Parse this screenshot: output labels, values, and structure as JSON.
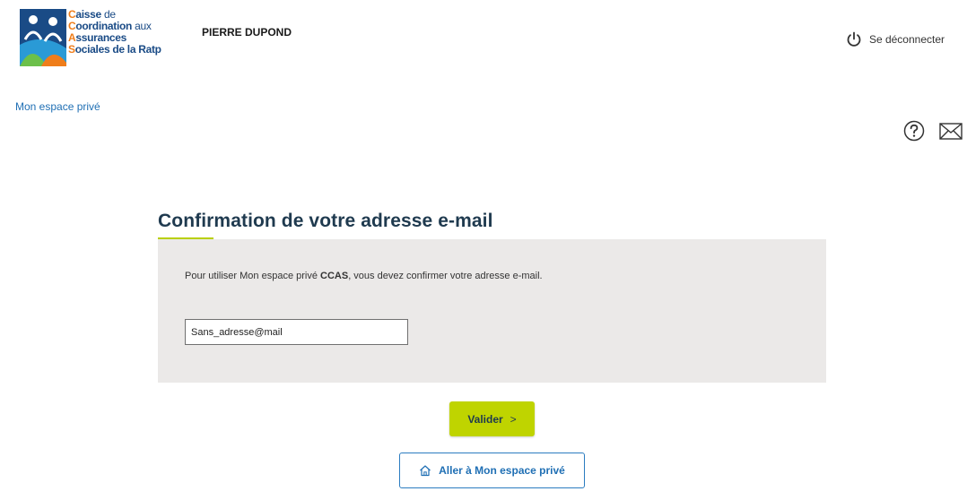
{
  "header": {
    "logo": {
      "lines": [
        {
          "cap": "C",
          "rest": "aisse",
          "light": " de"
        },
        {
          "cap": "C",
          "rest": "oordination",
          "light": " aux"
        },
        {
          "cap": "A",
          "rest": "ssurances",
          "light": ""
        },
        {
          "cap": "S",
          "rest": "ociales de la Ratp",
          "light": ""
        }
      ]
    },
    "user_name": "PIERRE DUPOND",
    "logout_label": "Se déconnecter",
    "breadcrumb": "Mon espace privé"
  },
  "main": {
    "title": "Confirmation de votre adresse e-mail",
    "instruction_before": "Pour utiliser Mon espace privé ",
    "instruction_bold": "CCAS",
    "instruction_after": ", vous devez confirmer votre adresse e-mail.",
    "email_value": "Sans_adresse@mail",
    "validate_label": "Valider",
    "validate_chevron": ">",
    "home_label": "Aller à Mon espace privé"
  },
  "icons": {
    "logout": "power-icon",
    "help": "question-icon",
    "mail": "envelope-icon",
    "home": "home-icon"
  },
  "colors": {
    "accent_green": "#bfd400",
    "link_blue": "#1f6fb4",
    "title_dark": "#1f3a4f",
    "panel_gray": "#ebe9e8",
    "logo_blue": "#1a4b86",
    "logo_orange": "#ef7d1a"
  }
}
